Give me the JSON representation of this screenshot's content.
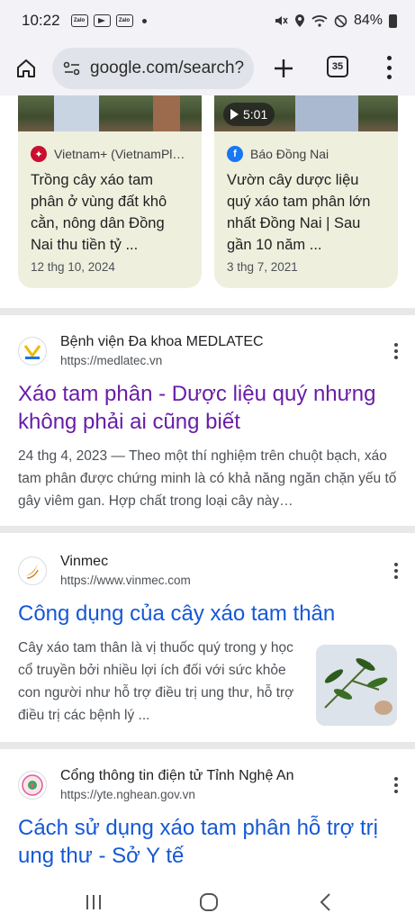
{
  "status_bar": {
    "time": "10:22",
    "notif_icons": [
      "Zalo",
      "Zalo",
      "Zalo"
    ],
    "battery": "84%"
  },
  "browser": {
    "url": "google.com/search?",
    "tab_count": "35"
  },
  "news_cards": [
    {
      "source": "Vietnam+ (VietnamPl…",
      "title": "Trồng cây xáo tam phân ở vùng đất khô cằn, nông dân Đồng Nai thu tiền tỷ ...",
      "date": "12 thg 10, 2024",
      "icon_color": "#c8102e"
    },
    {
      "source": "Báo Đồng Nai",
      "title": "Vườn cây dược liệu quý xáo tam phân lớn nhất Đồng Nai | Sau gần 10 năm ...",
      "date": "3 thg 7, 2021",
      "duration": "5:01",
      "icon_color": "#1877f2"
    }
  ],
  "results": [
    {
      "site_name": "Bệnh viện Đa khoa MEDLATEC",
      "site_url": "https://medlatec.vn",
      "title": "Xáo tam phân - Dược liệu quý nhưng không phải ai cũng biết",
      "snippet": "24 thg 4, 2023 — Theo một thí nghiệm trên chuột bạch, xáo tam phân được chứng minh là có khả năng ngăn chặn yếu tố gây viêm gan. Hợp chất trong loại cây này…",
      "visited": true
    },
    {
      "site_name": "Vinmec",
      "site_url": "https://www.vinmec.com",
      "title": "Công dụng của cây xáo tam thân",
      "snippet": "Cây xáo tam thân là vị thuốc quý trong y học cổ truyền bởi nhiều lợi ích đối với sức khỏe con người như hỗ trợ điều trị ung thư, hỗ trợ điều trị các bệnh lý ...",
      "visited": false
    },
    {
      "site_name": "Cổng thông tin điện tử Tỉnh Nghệ An",
      "site_url": "https://yte.nghean.gov.vn",
      "title": "Cách sử dụng xáo tam phân hỗ trợ trị ung thư - Sở Y tế",
      "visited": false
    }
  ],
  "colors": {
    "visited_link": "#681da8",
    "link": "#1558d6",
    "card_bg": "#efefde"
  }
}
